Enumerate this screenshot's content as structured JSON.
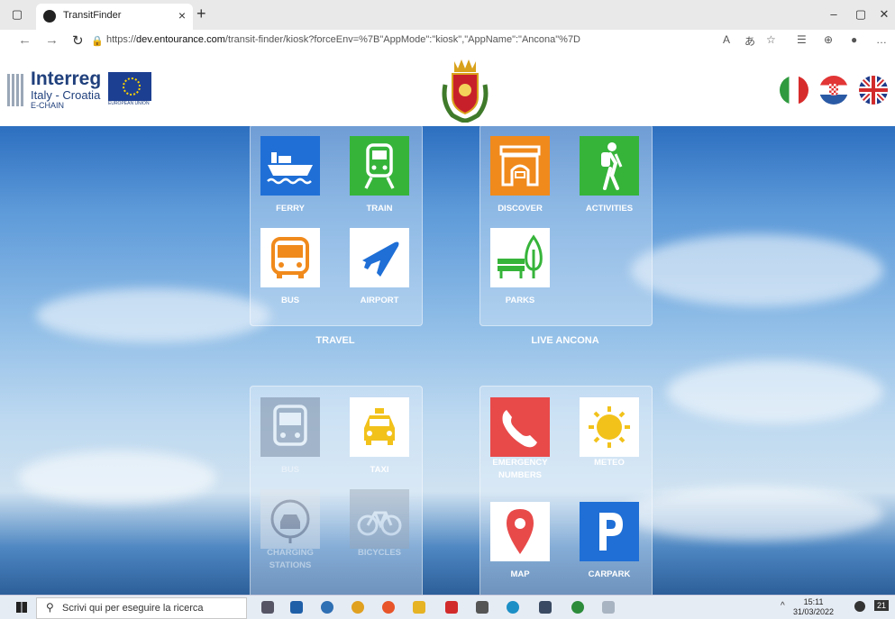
{
  "browser": {
    "tab_title": "TransitFinder",
    "url_prefix": "https://",
    "url_domain": "dev.entourance.com",
    "url_path": "/transit-finder/kiosk?forceEnv=%7B\"AppMode\":\"kiosk\",\"AppName\":\"Ancona\"%7D",
    "new_tab_glyph": "+",
    "close_glyph": "×"
  },
  "header": {
    "logo_title": "Interreg",
    "logo_sub": "Italy - Croatia",
    "logo_program": "E-CHAIN",
    "eu_label": "EUROPEAN UNION",
    "languages": [
      "it-flag-icon",
      "hr-flag-icon",
      "gb-flag-icon"
    ]
  },
  "groups": {
    "travel": {
      "label": "TRAVEL",
      "tiles": [
        {
          "label": "FERRY",
          "icon": "ferry-icon",
          "color": "#1f6fd6"
        },
        {
          "label": "TRAIN",
          "icon": "train-icon",
          "color": "#36b43a"
        },
        {
          "label": "BUS",
          "icon": "bus-icon",
          "color": "#f08a1c"
        },
        {
          "label": "AIRPORT",
          "icon": "airplane-icon",
          "color": "#1f6fd6"
        }
      ]
    },
    "live": {
      "label": "LIVE ANCONA",
      "tiles": [
        {
          "label": "DISCOVER",
          "icon": "arch-icon",
          "color": "#f08a1c"
        },
        {
          "label": "ACTIVITIES",
          "icon": "hiker-icon",
          "color": "#36b43a"
        },
        {
          "label": "PARKS",
          "icon": "park-bench-icon",
          "color": "#36b43a"
        }
      ]
    },
    "mobility": {
      "tiles": [
        {
          "label": "BUS",
          "icon": "bus-front-icon"
        },
        {
          "label": "TAXI",
          "icon": "taxi-icon",
          "color": "#f2c21b"
        },
        {
          "label": "CHARGING STATIONS",
          "icon": "charging-station-icon"
        },
        {
          "label": "BICYCLES",
          "icon": "bicycle-icon"
        }
      ]
    },
    "services": {
      "tiles": [
        {
          "label": "EMERGENCY NUMBERS",
          "icon": "phone-icon",
          "color": "#e84a4a"
        },
        {
          "label": "METEO",
          "icon": "sun-icon",
          "color": "#f2c21b"
        },
        {
          "label": "MAP",
          "icon": "map-pin-icon",
          "color": "#e84a4a"
        },
        {
          "label": "CARPARK",
          "icon": "parking-icon",
          "color": "#1f6fd6"
        }
      ]
    }
  },
  "taskbar": {
    "search_placeholder": "Scrivi qui per eseguire la ricerca",
    "time": "15:11",
    "date": "31/03/2022",
    "notifications": "21"
  }
}
